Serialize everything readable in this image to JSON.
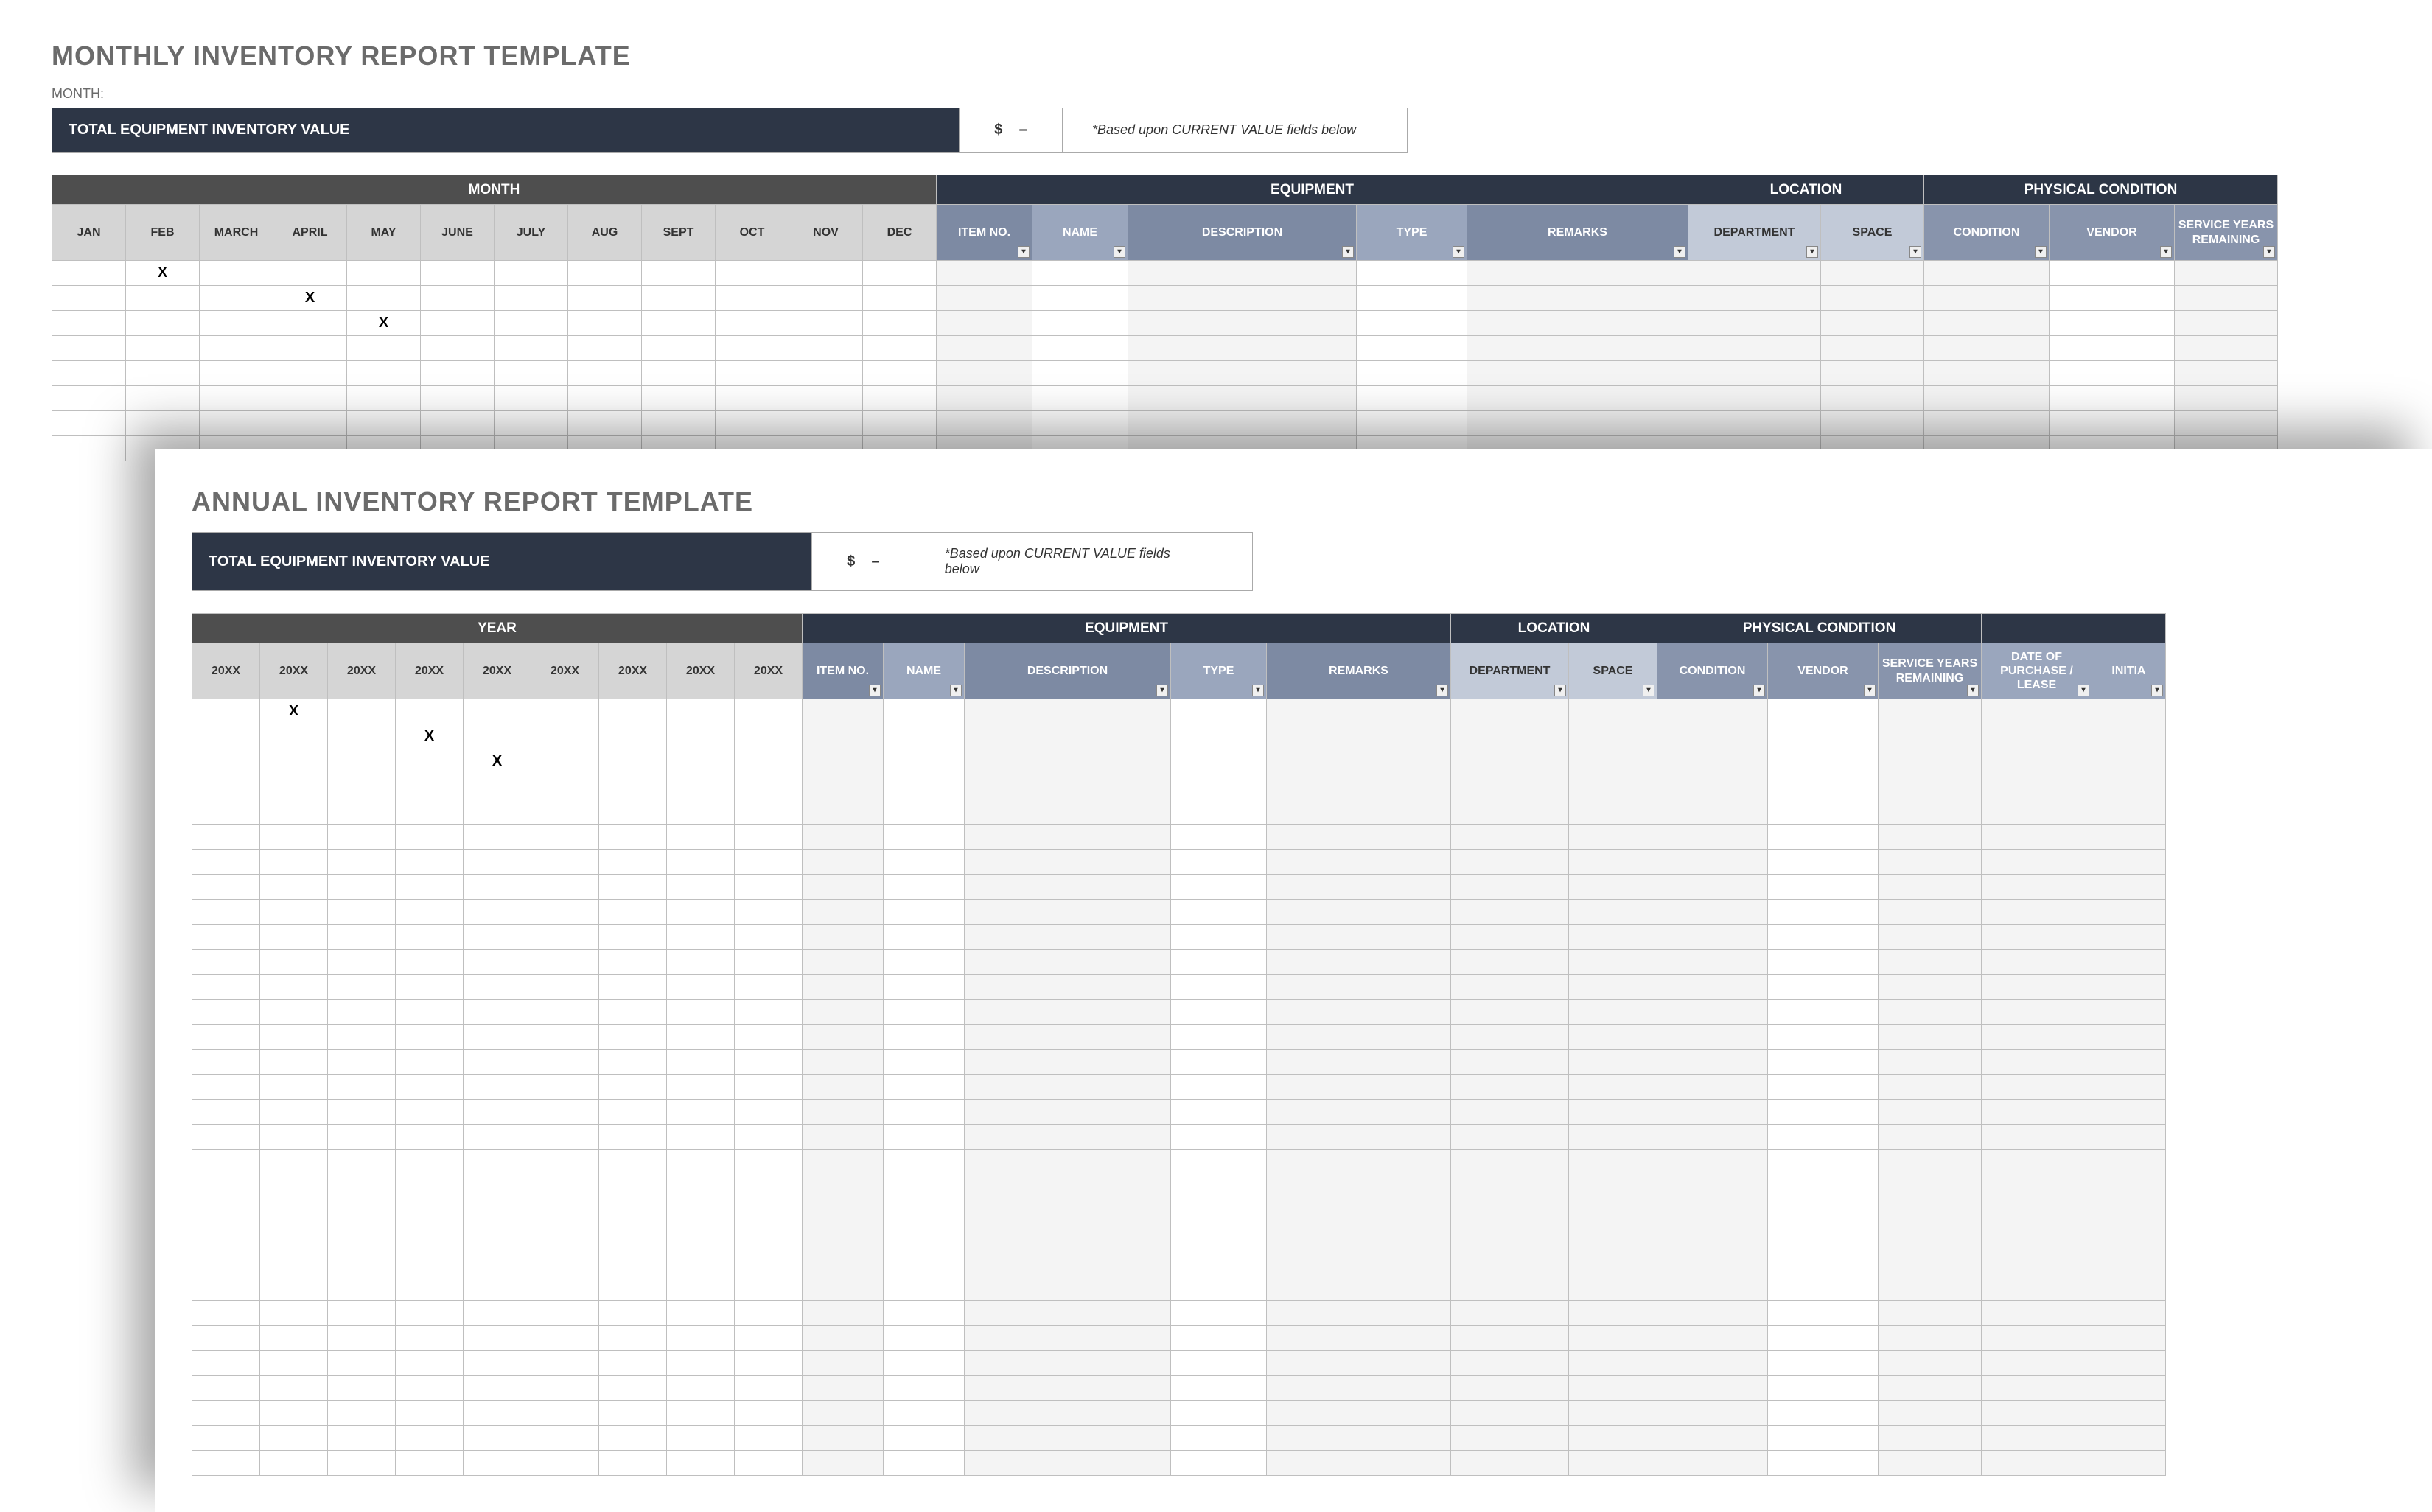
{
  "monthly": {
    "title": "MONTHLY INVENTORY REPORT TEMPLATE",
    "month_label": "MONTH:",
    "total_label": "TOTAL EQUIPMENT INVENTORY VALUE",
    "total_currency": "$",
    "total_value": "–",
    "total_note": "*Based upon CURRENT VALUE fields below",
    "group_headers": {
      "period": "MONTH",
      "equipment": "EQUIPMENT",
      "location": "LOCATION",
      "physical": "PHYSICAL CONDITION"
    },
    "period_cols": [
      "JAN",
      "FEB",
      "MARCH",
      "APRIL",
      "MAY",
      "JUNE",
      "JULY",
      "AUG",
      "SEPT",
      "OCT",
      "NOV",
      "DEC"
    ],
    "equip_cols": [
      "ITEM NO.",
      "NAME",
      "DESCRIPTION",
      "TYPE",
      "REMARKS"
    ],
    "location_cols": [
      "DEPARTMENT",
      "SPACE"
    ],
    "physical_cols": [
      "CONDITION",
      "VENDOR",
      "SERVICE YEARS REMAINING"
    ],
    "marks": [
      {
        "row": 0,
        "col": 1,
        "val": "X"
      },
      {
        "row": 1,
        "col": 3,
        "val": "X"
      },
      {
        "row": 2,
        "col": 4,
        "val": "X"
      }
    ],
    "blank_rows": 5
  },
  "annual": {
    "title": "ANNUAL INVENTORY REPORT TEMPLATE",
    "total_label": "TOTAL EQUIPMENT INVENTORY VALUE",
    "total_currency": "$",
    "total_value": "–",
    "total_note": "*Based upon CURRENT VALUE fields below",
    "group_headers": {
      "period": "YEAR",
      "equipment": "EQUIPMENT",
      "location": "LOCATION",
      "physical": "PHYSICAL CONDITION",
      "other": ""
    },
    "period_cols": [
      "20XX",
      "20XX",
      "20XX",
      "20XX",
      "20XX",
      "20XX",
      "20XX",
      "20XX",
      "20XX"
    ],
    "equip_cols": [
      "ITEM NO.",
      "NAME",
      "DESCRIPTION",
      "TYPE",
      "REMARKS"
    ],
    "location_cols": [
      "DEPARTMENT",
      "SPACE"
    ],
    "physical_cols": [
      "CONDITION",
      "VENDOR",
      "SERVICE YEARS REMAINING"
    ],
    "other_cols": [
      "DATE OF PURCHASE / LEASE",
      "INITIA"
    ],
    "marks": [
      {
        "row": 0,
        "col": 1,
        "val": "X"
      },
      {
        "row": 1,
        "col": 3,
        "val": "X"
      },
      {
        "row": 2,
        "col": 4,
        "val": "X"
      }
    ],
    "blank_rows": 28
  },
  "icons": {
    "filter": "▾"
  }
}
